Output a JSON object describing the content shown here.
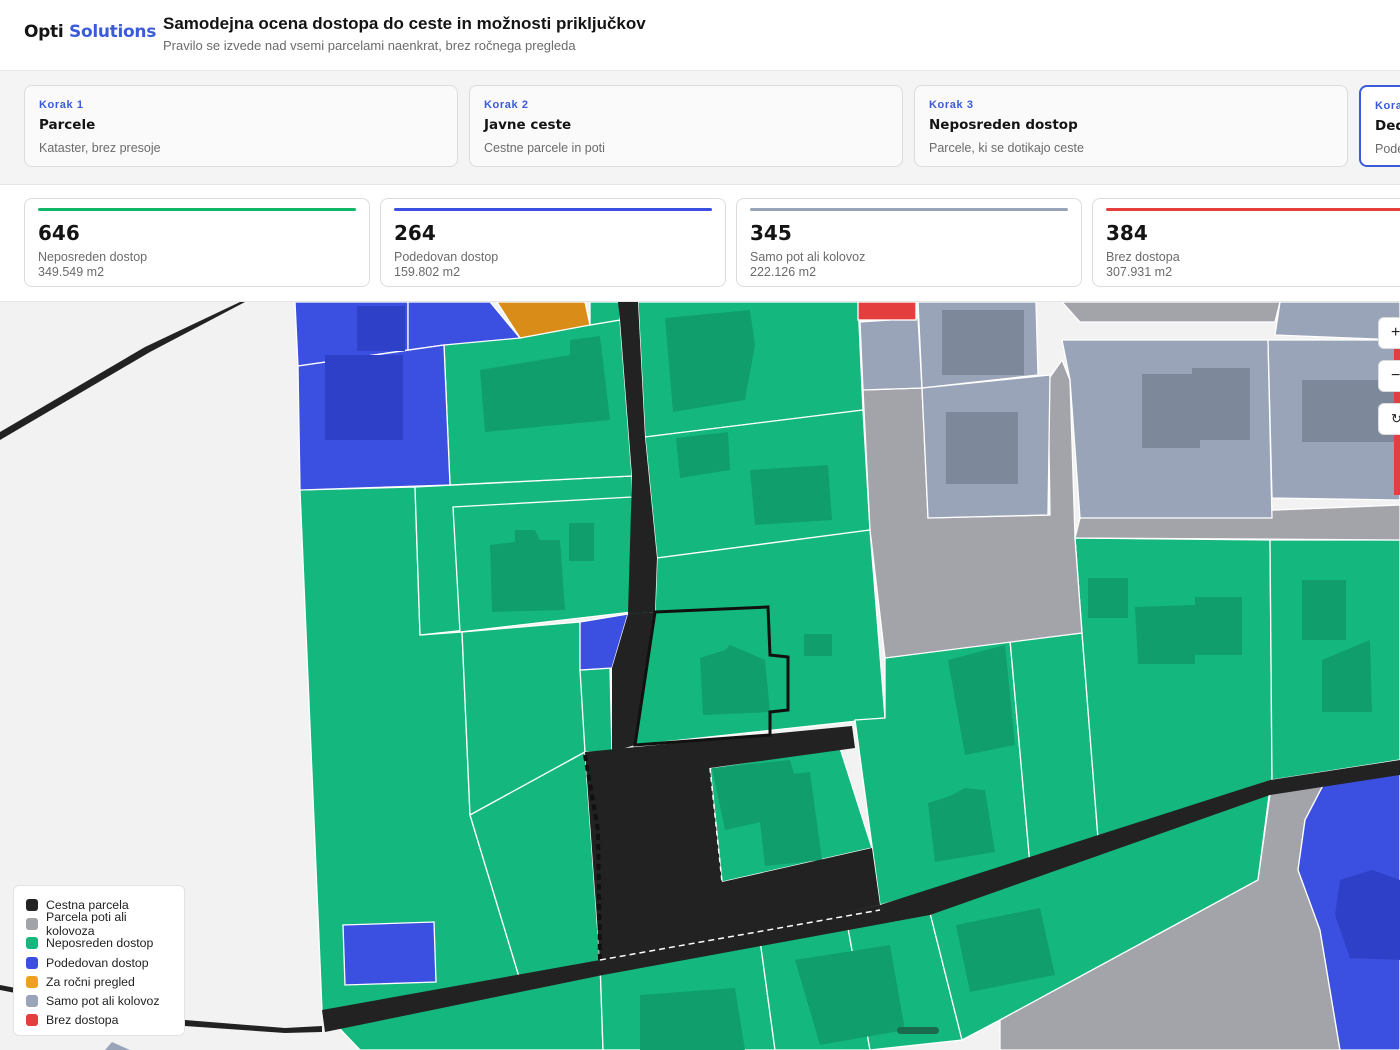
{
  "header": {
    "logo_part1": "Opti",
    "logo_part2": "Solutions",
    "title": "Samodejna ocena dostopa do ceste in možnosti priključkov",
    "subtitle": "Pravilo se izvede nad vsemi parcelami naenkrat, brez ročnega pregleda"
  },
  "steps": [
    {
      "kicker": "Korak 1",
      "title": "Parcele",
      "desc": "Kataster, brez presoje"
    },
    {
      "kicker": "Korak 2",
      "title": "Javne ceste",
      "desc": "Cestne parcele in poti"
    },
    {
      "kicker": "Korak 3",
      "title": "Neposreden dostop",
      "desc": "Parcele, ki se dotikajo ceste"
    },
    {
      "kicker": "Kora",
      "title": "Ded",
      "desc": "Pode"
    }
  ],
  "stats": [
    {
      "value": "646",
      "label": "Neposreden dostop",
      "area": "349.549 m2",
      "color": "#12b76a"
    },
    {
      "value": "264",
      "label": "Podedovan dostop",
      "area": "159.802 m2",
      "color": "#3b4fe0"
    },
    {
      "value": "345",
      "label": "Samo pot ali kolovoz",
      "area": "222.126 m2",
      "color": "#9aa4b8"
    },
    {
      "value": "384",
      "label": "Brez dostopa",
      "area": "307.931 m2",
      "color": "#e53e3e"
    }
  ],
  "controls": {
    "zoom_in": "+",
    "zoom_out": "−",
    "reset": "↻"
  },
  "legend": [
    {
      "label": "Cestna parcela",
      "color": "#222222"
    },
    {
      "label": "Parcela poti ali kolovoza",
      "color": "#a3a3aa"
    },
    {
      "label": "Neposreden dostop",
      "color": "#14b87e"
    },
    {
      "label": "Podedovan dostop",
      "color": "#3b4fe0"
    },
    {
      "label": "Za ročni pregled",
      "color": "#f0a020"
    },
    {
      "label": "Samo pot ali kolovoz",
      "color": "#9aa4b8"
    },
    {
      "label": "Brez dostopa",
      "color": "#e53e3e"
    }
  ]
}
